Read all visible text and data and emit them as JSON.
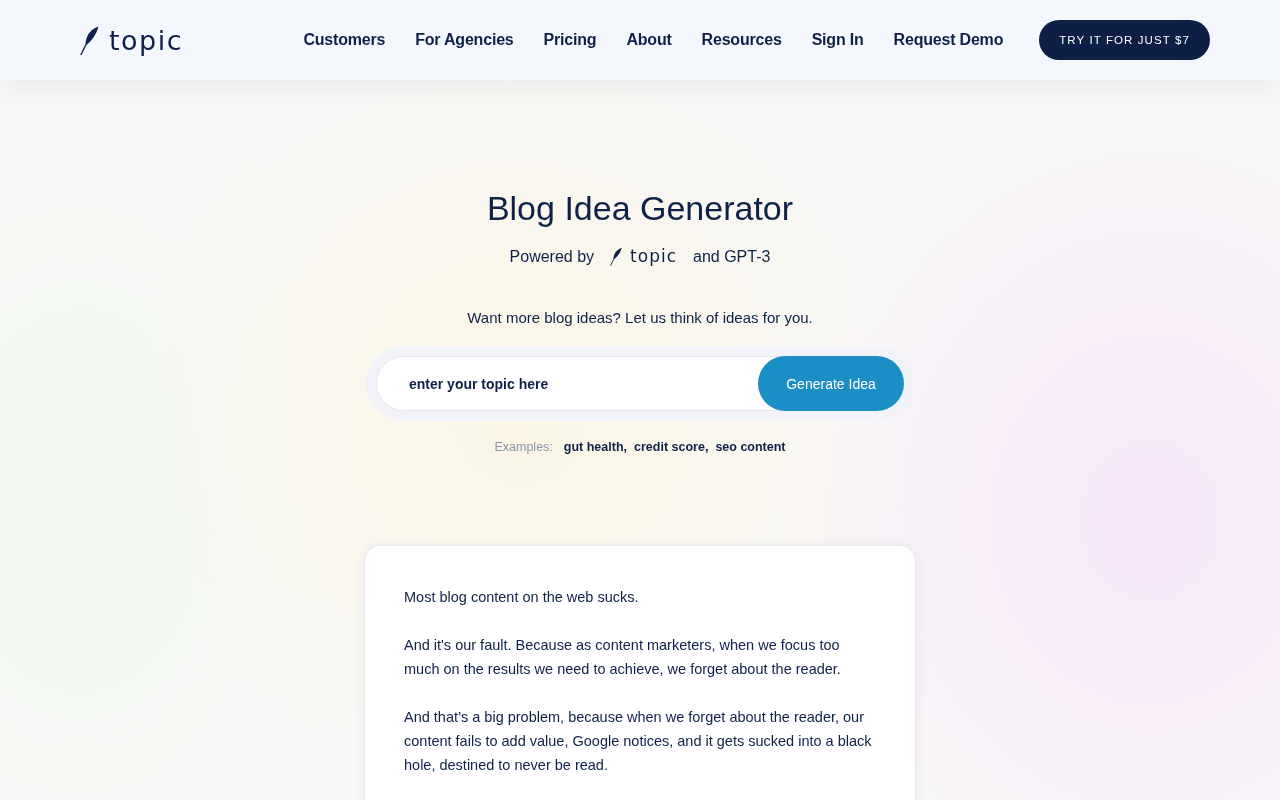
{
  "header": {
    "logo": {
      "text": "topic"
    },
    "nav": [
      {
        "label": "Customers"
      },
      {
        "label": "For Agencies"
      },
      {
        "label": "Pricing"
      },
      {
        "label": "About"
      },
      {
        "label": "Resources"
      },
      {
        "label": "Sign In"
      },
      {
        "label": "Request Demo"
      }
    ],
    "cta": "TRY IT FOR JUST $7"
  },
  "hero": {
    "title": "Blog Idea Generator",
    "powered_by": {
      "prefix": "Powered by",
      "logo_text": "topic",
      "suffix": "and GPT-3"
    },
    "prompt": "Want more blog ideas? Let us think of ideas for you.",
    "search": {
      "placeholder": "enter your topic here",
      "button": "Generate Idea"
    },
    "examples": {
      "label": "Examples:",
      "items": [
        "gut health,",
        "credit score,",
        "seo content"
      ]
    }
  },
  "article": {
    "paragraphs": [
      "Most blog content on the web sucks.",
      "And it's our fault. Because as content marketers, when we focus too much on the results we need to achieve, we forget about the reader.",
      "And that’s a big problem, because when we forget about the reader, our content fails to add value, Google notices, and it gets sucked into a black hole, destined to never be read."
    ]
  }
}
